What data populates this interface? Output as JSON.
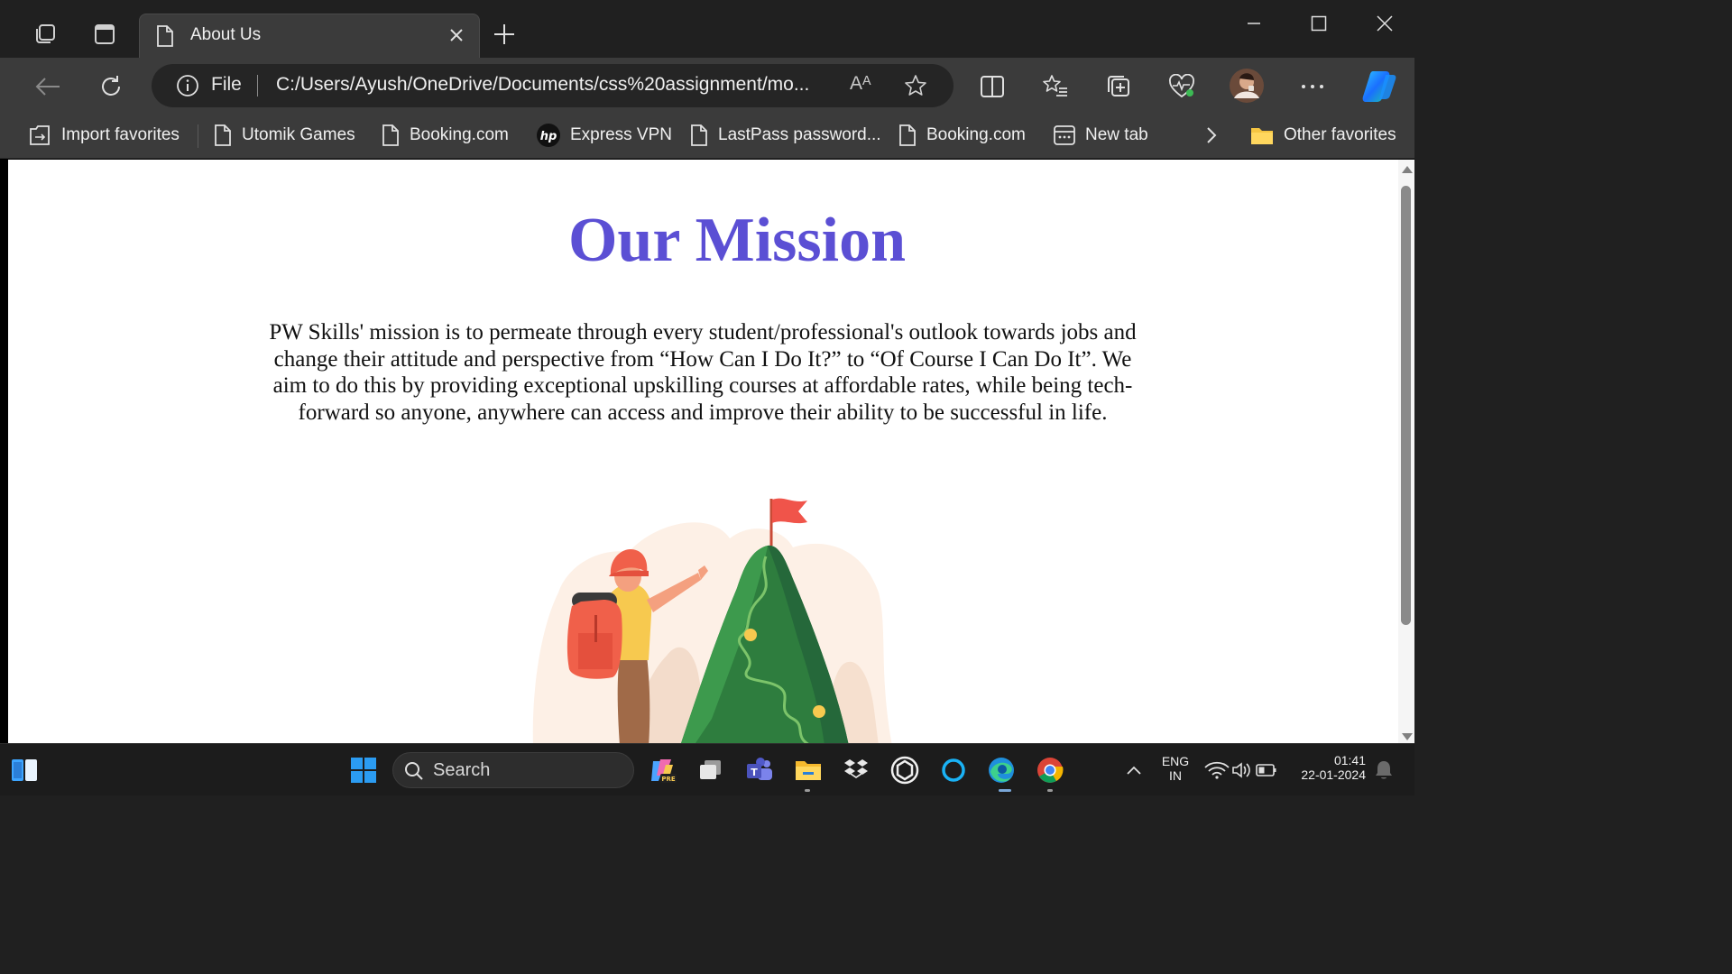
{
  "browser": {
    "tab": {
      "title": "About Us"
    },
    "address_bar": {
      "scheme_label": "File",
      "url": "C:/Users/Ayush/OneDrive/Documents/css%20assignment/mo...",
      "read_aloud_label": "Aᴬ"
    },
    "favorites": [
      {
        "label": "Import favorites",
        "icon": "import-icon"
      },
      {
        "label": "Utomik Games",
        "icon": "page-icon"
      },
      {
        "label": "Booking.com",
        "icon": "page-icon"
      },
      {
        "label": "Express VPN",
        "icon": "hp-logo-icon"
      },
      {
        "label": "LastPass password...",
        "icon": "page-icon"
      },
      {
        "label": "Booking.com",
        "icon": "page-icon"
      },
      {
        "label": "New tab",
        "icon": "new-tab-icon"
      }
    ],
    "other_favorites": "Other favorites"
  },
  "page": {
    "heading": "Our Mission",
    "mission_text": "PW Skills' mission is to permeate through every student/professional's outlook towards jobs and change their attitude and perspective from “How Can I Do It?” to “Of Course I Can Do It”. We aim to do this by providing exceptional upskilling courses at affordable rates, while being tech-forward so anyone, anywhere can access and improve their ability to be successful in life.",
    "colors": {
      "heading": "#5b4fd4",
      "mountain": "#2e7d3e",
      "flag": "#f0544a",
      "backpack": "#f0604a"
    }
  },
  "taskbar": {
    "search_placeholder": "Search",
    "language": "ENG",
    "region": "IN",
    "time": "01:41",
    "date": "22-01-2024"
  }
}
